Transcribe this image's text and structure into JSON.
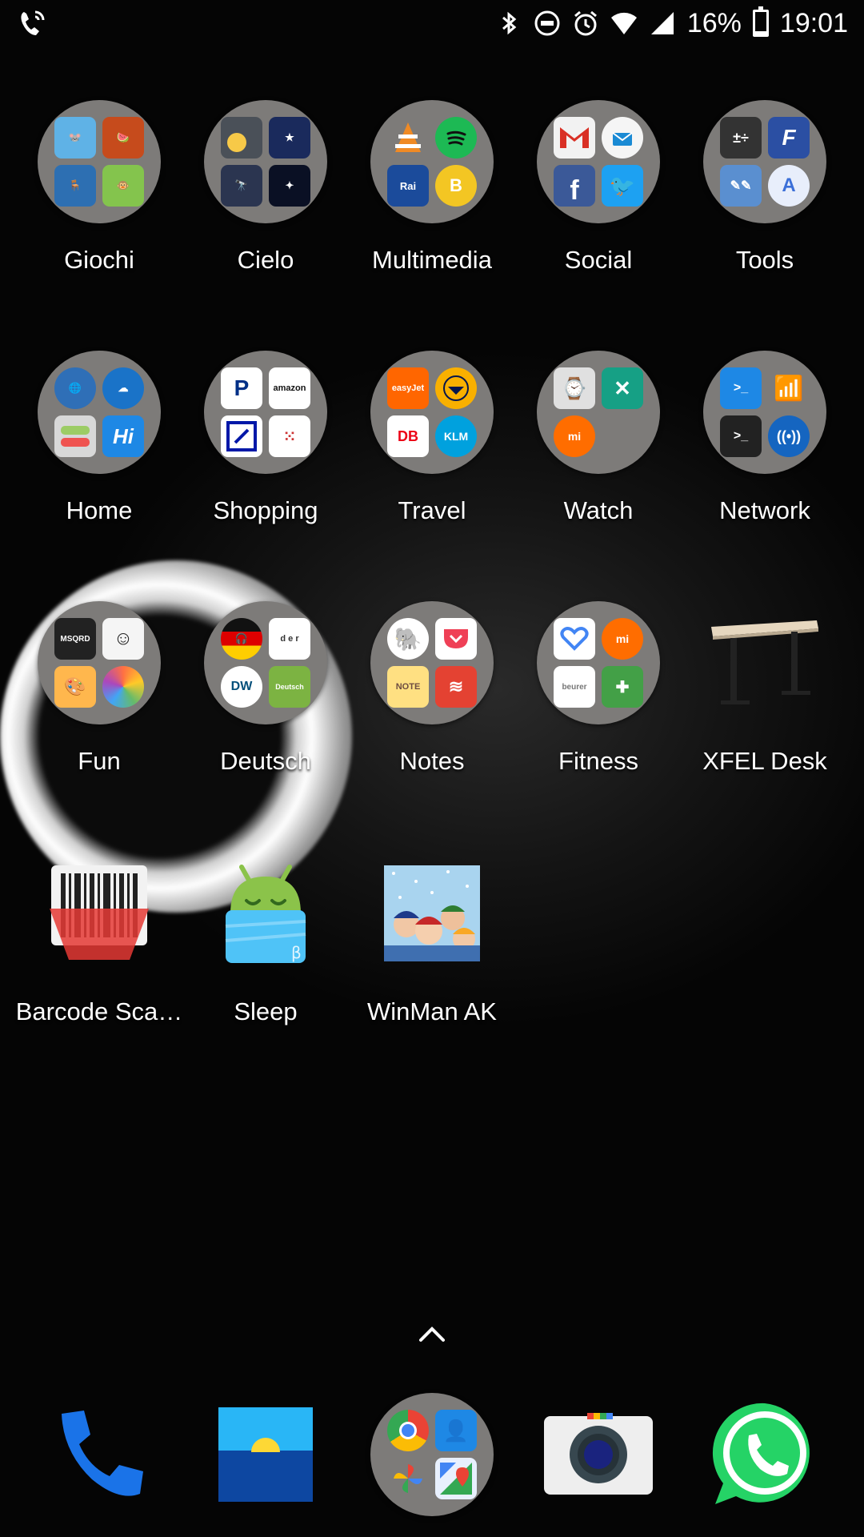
{
  "status_bar": {
    "battery": "16%",
    "time": "19:01",
    "icons": [
      "wifi-call-icon",
      "bluetooth-icon",
      "do-not-disturb-icon",
      "alarm-icon",
      "wifi-icon",
      "signal-icon",
      "battery-icon"
    ]
  },
  "home": {
    "rows": [
      [
        {
          "label": "Giochi",
          "type": "folder"
        },
        {
          "label": "Cielo",
          "type": "folder"
        },
        {
          "label": "Multimedia",
          "type": "folder"
        },
        {
          "label": "Social",
          "type": "folder"
        },
        {
          "label": "Tools",
          "type": "folder"
        }
      ],
      [
        {
          "label": "Home",
          "type": "folder"
        },
        {
          "label": "Shopping",
          "type": "folder"
        },
        {
          "label": "Travel",
          "type": "folder"
        },
        {
          "label": "Watch",
          "type": "folder"
        },
        {
          "label": "Network",
          "type": "folder"
        }
      ],
      [
        {
          "label": "Fun",
          "type": "folder"
        },
        {
          "label": "Deutsch",
          "type": "folder"
        },
        {
          "label": "Notes",
          "type": "folder"
        },
        {
          "label": "Fitness",
          "type": "folder"
        },
        {
          "label": "XFEL Desk",
          "type": "app"
        }
      ],
      [
        {
          "label": "Barcode Sca…",
          "type": "app"
        },
        {
          "label": "Sleep",
          "type": "app"
        },
        {
          "label": "WinMan AK",
          "type": "app"
        }
      ]
    ],
    "mini_text": {
      "msqrd": "MSQRD",
      "amazon": "amazon",
      "easyjet": "easyJet",
      "db": "DB",
      "klm": "KLM",
      "dw": "DW",
      "note": "NOTE",
      "mi": "mi",
      "hi": "Hi",
      "beurer": "beurer"
    }
  },
  "dock": {
    "apps": [
      "phone-icon",
      "wallpaper-icon",
      "google-folder-icon",
      "camera-icon",
      "whatsapp-icon"
    ]
  },
  "colors": {
    "folder_bg": "#7d7b79",
    "phone_blue": "#1a73e8",
    "whatsapp_green": "#25d366"
  }
}
